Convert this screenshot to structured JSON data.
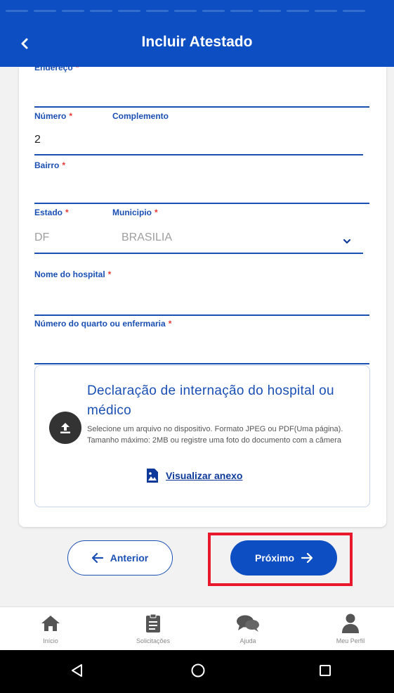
{
  "header": {
    "title": "Incluir Atestado",
    "back_icon": "chevron-left-icon"
  },
  "form": {
    "endereco_label": "Endereço",
    "numero_label": "Número",
    "numero_value": "2",
    "complemento_label": "Complemento",
    "bairro_label": "Bairro",
    "estado_label": "Estado",
    "estado_value": "DF",
    "municipio_label": "Municipio",
    "municipio_value": "BRASILIA",
    "hospital_label": "Nome do hospital",
    "quarto_label": "Número do quarto ou enfermaria",
    "required_mark": "*"
  },
  "upload": {
    "title": "Declaração de internação do hospital ou médico",
    "description": "Selecione um arquivo no dispositivo. Formato JPEG ou PDF(Uma página). Tamanho máximo: 2MB ou registre uma foto do documento com a câmera",
    "view_label": "Visualizar anexo"
  },
  "actions": {
    "prev_label": "Anterior",
    "next_label": "Próximo"
  },
  "bottom_nav": [
    {
      "label": "Início",
      "icon": "home-icon"
    },
    {
      "label": "Solicitações",
      "icon": "clipboard-icon"
    },
    {
      "label": "Ajuda",
      "icon": "chat-icon"
    },
    {
      "label": "Meu Perfil",
      "icon": "user-icon"
    }
  ],
  "colors": {
    "primary": "#0d4ec2",
    "required": "#e53935",
    "highlight": "#e8192c"
  }
}
